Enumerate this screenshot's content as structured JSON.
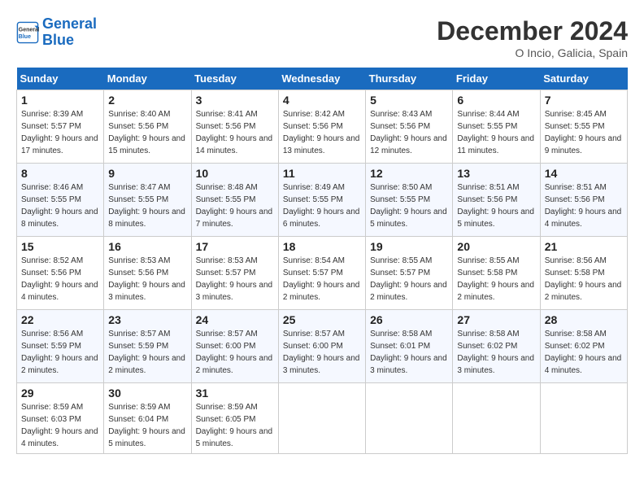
{
  "header": {
    "logo_general": "General",
    "logo_blue": "Blue",
    "month_title": "December 2024",
    "subtitle": "O Incio, Galicia, Spain"
  },
  "weekdays": [
    "Sunday",
    "Monday",
    "Tuesday",
    "Wednesday",
    "Thursday",
    "Friday",
    "Saturday"
  ],
  "weeks": [
    [
      {
        "day": "1",
        "sunrise": "Sunrise: 8:39 AM",
        "sunset": "Sunset: 5:57 PM",
        "daylight": "Daylight: 9 hours and 17 minutes."
      },
      {
        "day": "2",
        "sunrise": "Sunrise: 8:40 AM",
        "sunset": "Sunset: 5:56 PM",
        "daylight": "Daylight: 9 hours and 15 minutes."
      },
      {
        "day": "3",
        "sunrise": "Sunrise: 8:41 AM",
        "sunset": "Sunset: 5:56 PM",
        "daylight": "Daylight: 9 hours and 14 minutes."
      },
      {
        "day": "4",
        "sunrise": "Sunrise: 8:42 AM",
        "sunset": "Sunset: 5:56 PM",
        "daylight": "Daylight: 9 hours and 13 minutes."
      },
      {
        "day": "5",
        "sunrise": "Sunrise: 8:43 AM",
        "sunset": "Sunset: 5:56 PM",
        "daylight": "Daylight: 9 hours and 12 minutes."
      },
      {
        "day": "6",
        "sunrise": "Sunrise: 8:44 AM",
        "sunset": "Sunset: 5:55 PM",
        "daylight": "Daylight: 9 hours and 11 minutes."
      },
      {
        "day": "7",
        "sunrise": "Sunrise: 8:45 AM",
        "sunset": "Sunset: 5:55 PM",
        "daylight": "Daylight: 9 hours and 9 minutes."
      }
    ],
    [
      {
        "day": "8",
        "sunrise": "Sunrise: 8:46 AM",
        "sunset": "Sunset: 5:55 PM",
        "daylight": "Daylight: 9 hours and 8 minutes."
      },
      {
        "day": "9",
        "sunrise": "Sunrise: 8:47 AM",
        "sunset": "Sunset: 5:55 PM",
        "daylight": "Daylight: 9 hours and 8 minutes."
      },
      {
        "day": "10",
        "sunrise": "Sunrise: 8:48 AM",
        "sunset": "Sunset: 5:55 PM",
        "daylight": "Daylight: 9 hours and 7 minutes."
      },
      {
        "day": "11",
        "sunrise": "Sunrise: 8:49 AM",
        "sunset": "Sunset: 5:55 PM",
        "daylight": "Daylight: 9 hours and 6 minutes."
      },
      {
        "day": "12",
        "sunrise": "Sunrise: 8:50 AM",
        "sunset": "Sunset: 5:55 PM",
        "daylight": "Daylight: 9 hours and 5 minutes."
      },
      {
        "day": "13",
        "sunrise": "Sunrise: 8:51 AM",
        "sunset": "Sunset: 5:56 PM",
        "daylight": "Daylight: 9 hours and 5 minutes."
      },
      {
        "day": "14",
        "sunrise": "Sunrise: 8:51 AM",
        "sunset": "Sunset: 5:56 PM",
        "daylight": "Daylight: 9 hours and 4 minutes."
      }
    ],
    [
      {
        "day": "15",
        "sunrise": "Sunrise: 8:52 AM",
        "sunset": "Sunset: 5:56 PM",
        "daylight": "Daylight: 9 hours and 4 minutes."
      },
      {
        "day": "16",
        "sunrise": "Sunrise: 8:53 AM",
        "sunset": "Sunset: 5:56 PM",
        "daylight": "Daylight: 9 hours and 3 minutes."
      },
      {
        "day": "17",
        "sunrise": "Sunrise: 8:53 AM",
        "sunset": "Sunset: 5:57 PM",
        "daylight": "Daylight: 9 hours and 3 minutes."
      },
      {
        "day": "18",
        "sunrise": "Sunrise: 8:54 AM",
        "sunset": "Sunset: 5:57 PM",
        "daylight": "Daylight: 9 hours and 2 minutes."
      },
      {
        "day": "19",
        "sunrise": "Sunrise: 8:55 AM",
        "sunset": "Sunset: 5:57 PM",
        "daylight": "Daylight: 9 hours and 2 minutes."
      },
      {
        "day": "20",
        "sunrise": "Sunrise: 8:55 AM",
        "sunset": "Sunset: 5:58 PM",
        "daylight": "Daylight: 9 hours and 2 minutes."
      },
      {
        "day": "21",
        "sunrise": "Sunrise: 8:56 AM",
        "sunset": "Sunset: 5:58 PM",
        "daylight": "Daylight: 9 hours and 2 minutes."
      }
    ],
    [
      {
        "day": "22",
        "sunrise": "Sunrise: 8:56 AM",
        "sunset": "Sunset: 5:59 PM",
        "daylight": "Daylight: 9 hours and 2 minutes."
      },
      {
        "day": "23",
        "sunrise": "Sunrise: 8:57 AM",
        "sunset": "Sunset: 5:59 PM",
        "daylight": "Daylight: 9 hours and 2 minutes."
      },
      {
        "day": "24",
        "sunrise": "Sunrise: 8:57 AM",
        "sunset": "Sunset: 6:00 PM",
        "daylight": "Daylight: 9 hours and 2 minutes."
      },
      {
        "day": "25",
        "sunrise": "Sunrise: 8:57 AM",
        "sunset": "Sunset: 6:00 PM",
        "daylight": "Daylight: 9 hours and 3 minutes."
      },
      {
        "day": "26",
        "sunrise": "Sunrise: 8:58 AM",
        "sunset": "Sunset: 6:01 PM",
        "daylight": "Daylight: 9 hours and 3 minutes."
      },
      {
        "day": "27",
        "sunrise": "Sunrise: 8:58 AM",
        "sunset": "Sunset: 6:02 PM",
        "daylight": "Daylight: 9 hours and 3 minutes."
      },
      {
        "day": "28",
        "sunrise": "Sunrise: 8:58 AM",
        "sunset": "Sunset: 6:02 PM",
        "daylight": "Daylight: 9 hours and 4 minutes."
      }
    ],
    [
      {
        "day": "29",
        "sunrise": "Sunrise: 8:59 AM",
        "sunset": "Sunset: 6:03 PM",
        "daylight": "Daylight: 9 hours and 4 minutes."
      },
      {
        "day": "30",
        "sunrise": "Sunrise: 8:59 AM",
        "sunset": "Sunset: 6:04 PM",
        "daylight": "Daylight: 9 hours and 5 minutes."
      },
      {
        "day": "31",
        "sunrise": "Sunrise: 8:59 AM",
        "sunset": "Sunset: 6:05 PM",
        "daylight": "Daylight: 9 hours and 5 minutes."
      },
      null,
      null,
      null,
      null
    ]
  ]
}
